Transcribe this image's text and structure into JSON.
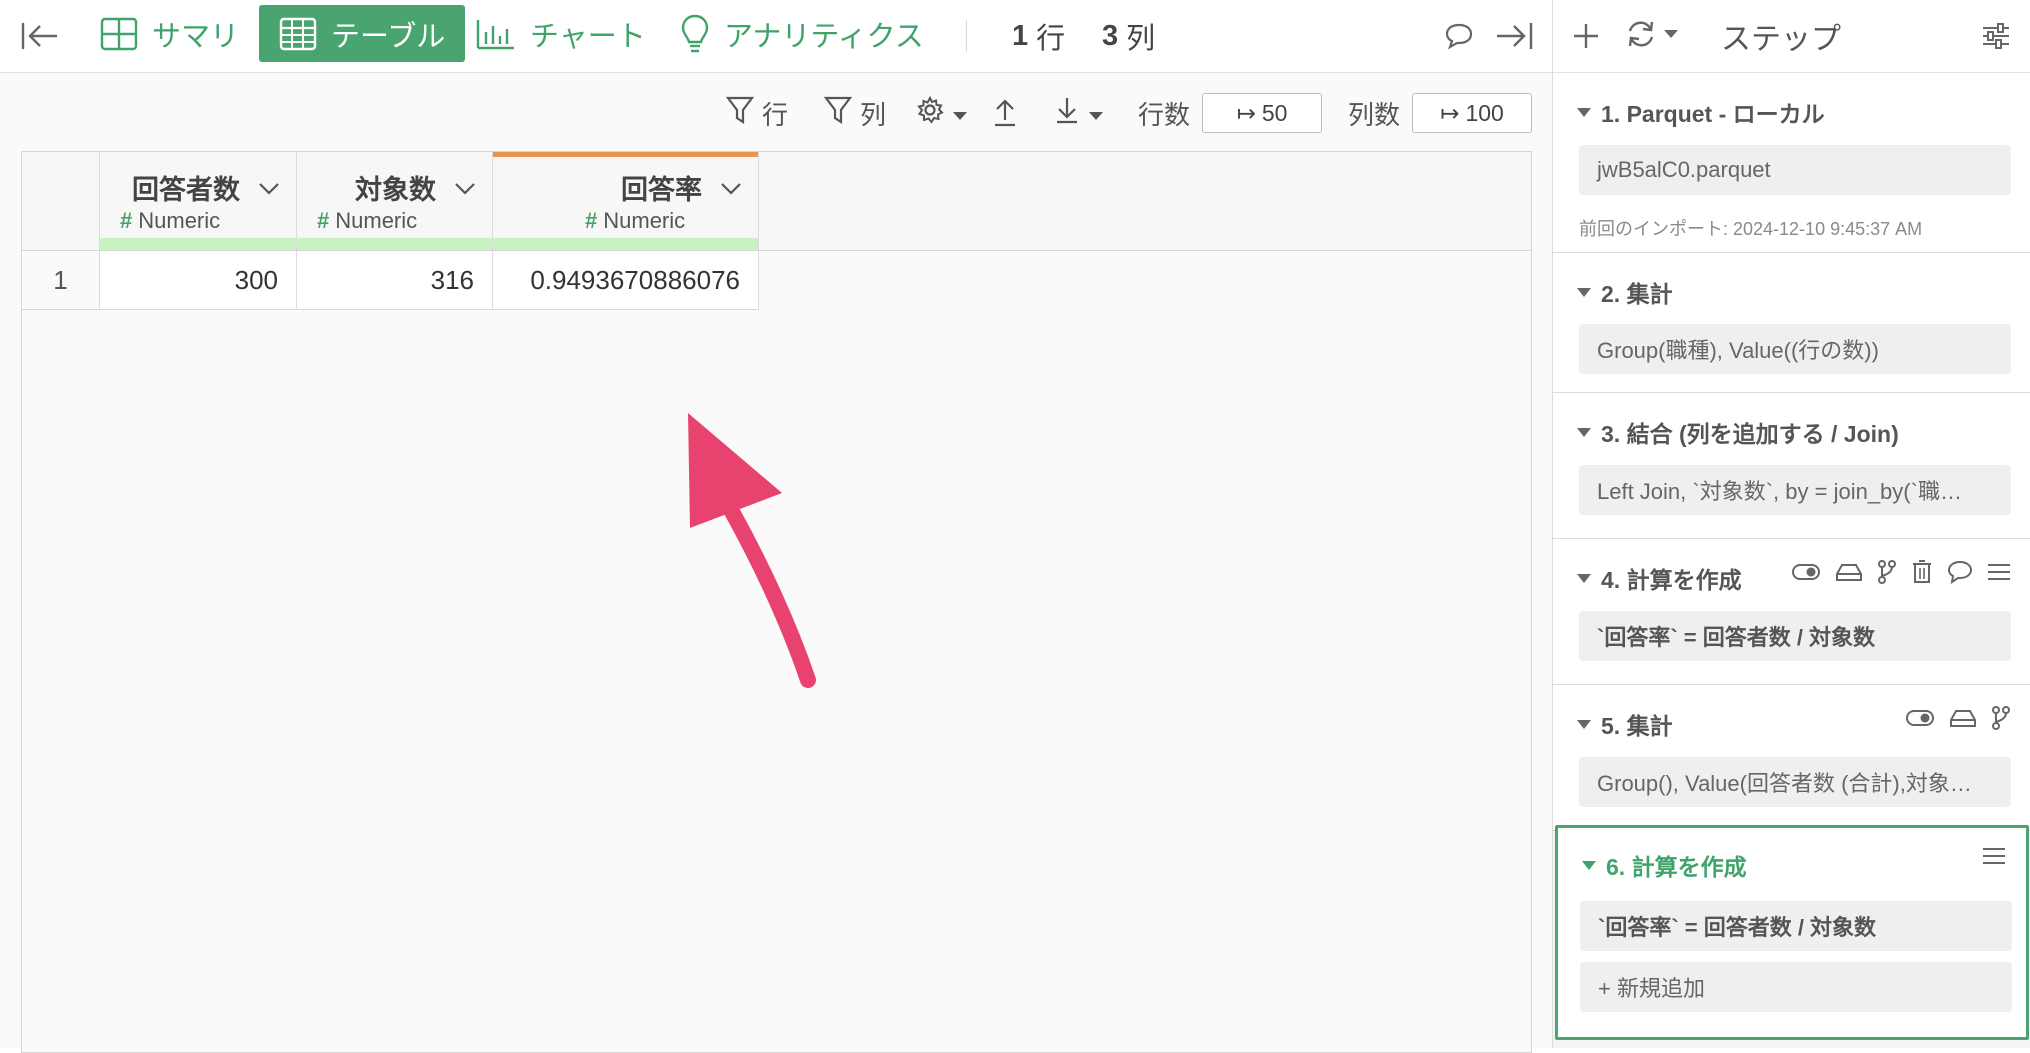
{
  "toolbar": {
    "tabs": [
      {
        "label": "サマリ",
        "icon": "grid-icon"
      },
      {
        "label": "テーブル",
        "icon": "table-icon"
      },
      {
        "label": "チャート",
        "icon": "bar-chart-icon"
      },
      {
        "label": "アナリティクス",
        "icon": "lightbulb-icon"
      }
    ],
    "rows_count": "1",
    "rows_unit": "行",
    "cols_count": "3",
    "cols_unit": "列"
  },
  "subbar": {
    "row_filter_label": "行",
    "col_filter_label": "列",
    "rows_label": "行数",
    "rows_value": "50",
    "cols_label": "列数",
    "cols_value": "100"
  },
  "table": {
    "columns": [
      {
        "name": "回答者数",
        "type": "Numeric"
      },
      {
        "name": "対象数",
        "type": "Numeric"
      },
      {
        "name": "回答率",
        "type": "Numeric"
      }
    ],
    "rows": [
      {
        "index": "1",
        "values": [
          "300",
          "316",
          "0.9493670886076"
        ]
      }
    ]
  },
  "panel": {
    "title": "ステップ",
    "steps": [
      {
        "title": "1. Parquet - ローカル",
        "detail": "jwB5alC0.parquet",
        "meta": "前回のインポート: 2024-12-10 9:45:37 AM"
      },
      {
        "title": "2. 集計",
        "detail": "Group(職種), Value((行の数))"
      },
      {
        "title": "3. 結合 (列を追加する / Join)",
        "detail": "Left Join, `対象数`, by = join_by(`職…"
      },
      {
        "title": "4. 計算を作成",
        "detail": "`回答率` = 回答者数 / 対象数"
      },
      {
        "title": "5. 集計",
        "detail": "Group(), Value(回答者数 (合計),対象…"
      },
      {
        "title": "6. 計算を作成",
        "detail": "`回答率` = 回答者数 / 対象数",
        "add_label": "+ 新規追加"
      }
    ]
  },
  "colors": {
    "accent": "#4aa46f",
    "annotation_arrow": "#e8436e",
    "column_highlight": "#e8954f"
  }
}
